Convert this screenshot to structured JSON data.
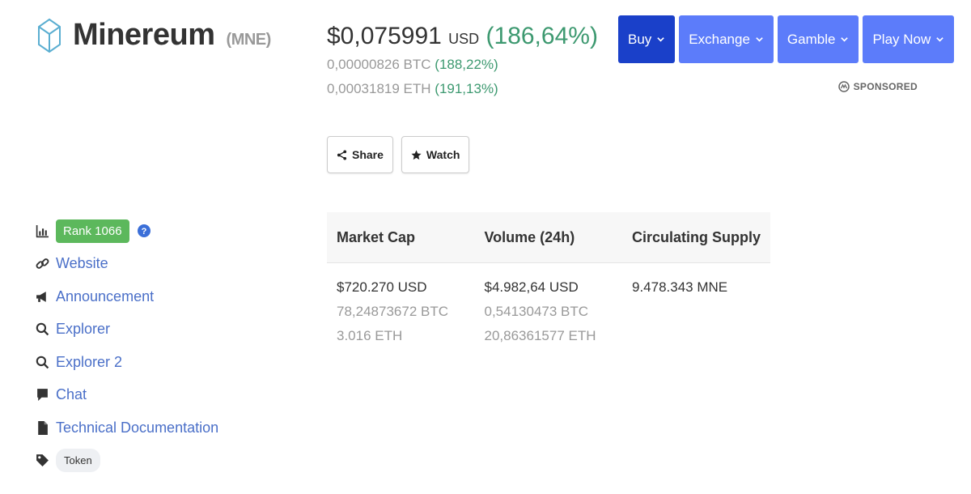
{
  "coin": {
    "name": "Minereum",
    "symbol": "(MNE)"
  },
  "price": {
    "value": "$0,075991",
    "unit": "USD",
    "change": "(186,64%)",
    "btc_value": "0,00000826 BTC",
    "btc_change": "(188,22%)",
    "eth_value": "0,00031819 ETH",
    "eth_change": "(191,13%)"
  },
  "actions": {
    "share": "Share",
    "watch": "Watch"
  },
  "top_buttons": [
    {
      "label": "Buy"
    },
    {
      "label": "Exchange"
    },
    {
      "label": "Gamble"
    },
    {
      "label": "Play Now"
    }
  ],
  "sponsored": "SPONSORED",
  "links": {
    "rank": "Rank 1066",
    "website": "Website",
    "announcement": "Announcement",
    "explorer": "Explorer",
    "explorer2": "Explorer 2",
    "chat": "Chat",
    "tech_docs": "Technical Documentation",
    "tag": "Token"
  },
  "stats": {
    "headers": [
      "Market Cap",
      "Volume (24h)",
      "Circulating Supply"
    ],
    "market_cap": {
      "usd": "$720.270 USD",
      "btc": "78,24873672 BTC",
      "eth": "3.016 ETH"
    },
    "volume": {
      "usd": "$4.982,64 USD",
      "btc": "0,54130473 BTC",
      "eth": "20,86361577 ETH"
    },
    "supply": {
      "value": "9.478.343 MNE"
    }
  },
  "colors": {
    "accent": "#5c7cfa",
    "accent_active": "#1a40c9",
    "positive": "#3d9970",
    "rank": "#5cb85c",
    "link": "#4a6fc8"
  }
}
